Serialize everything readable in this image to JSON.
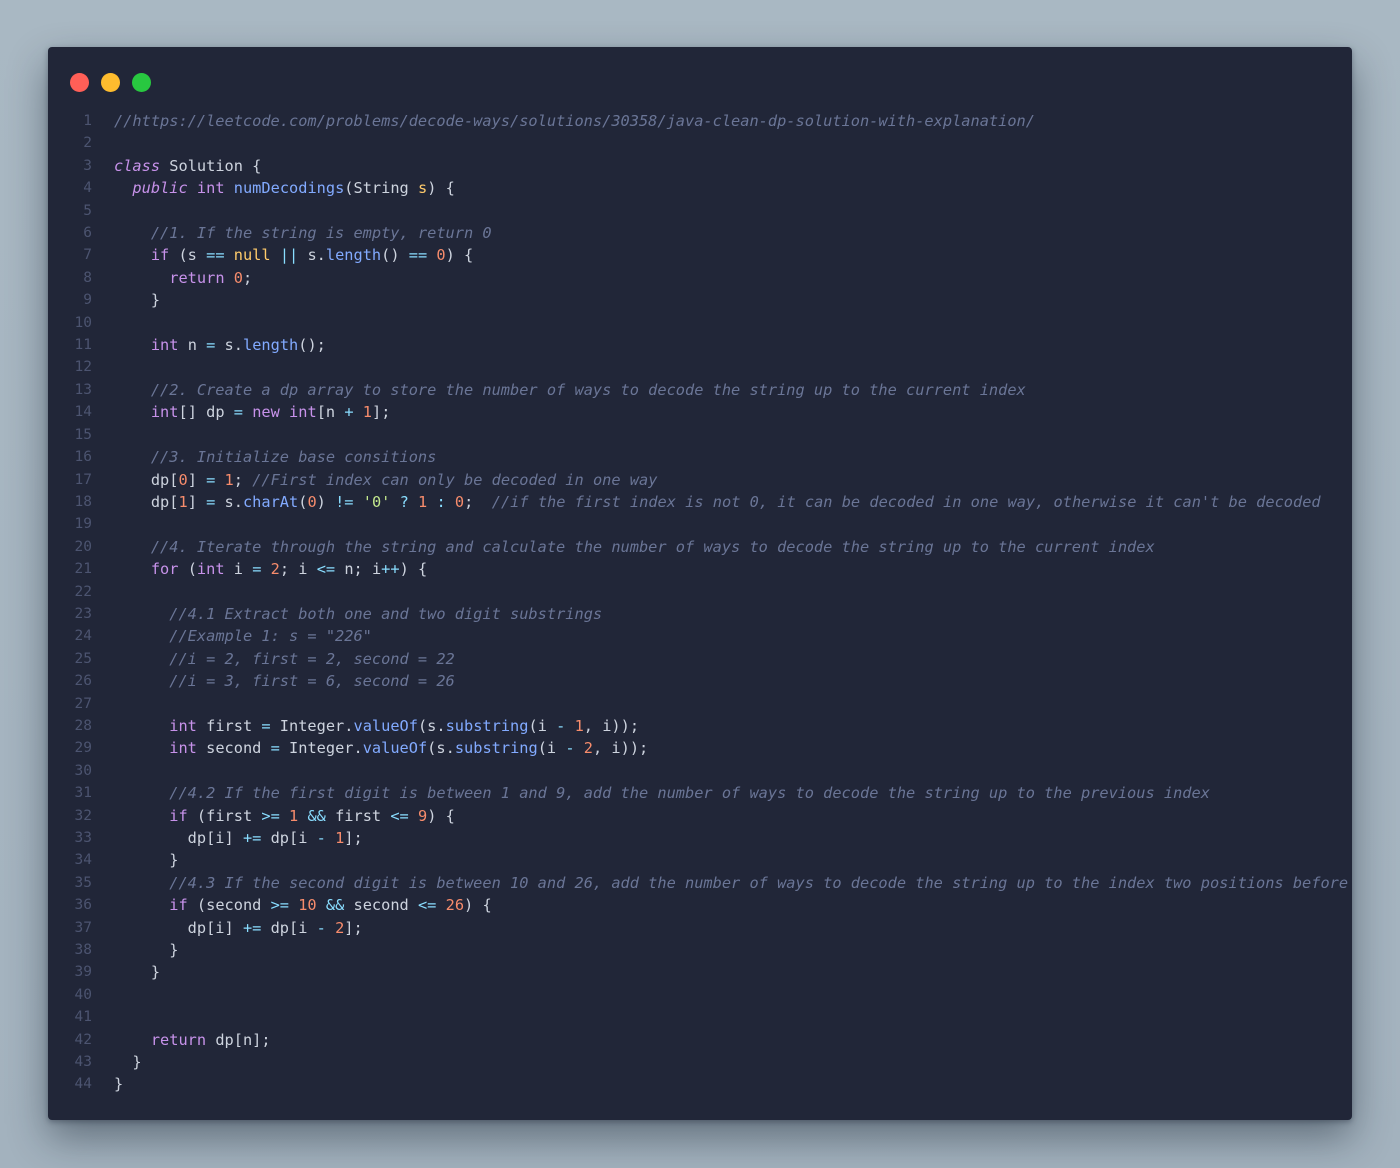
{
  "window": {
    "traffic_lights": [
      {
        "name": "close-dot",
        "color": "#ff5f57"
      },
      {
        "name": "minimize-dot",
        "color": "#febc2e"
      },
      {
        "name": "maximize-dot",
        "color": "#28c840"
      }
    ]
  },
  "syntax_colors": {
    "background": "#212638",
    "comment": "#6a7596",
    "keyword": "#c792ea",
    "number": "#f78c6c",
    "string": "#c3e88d",
    "function": "#82aaff",
    "operator": "#89ddff",
    "line_number": "#4c5470"
  },
  "code_lines": [
    [
      [
        "c",
        "//https://leetcode.com/problems/decode-ways/solutions/30358/java-clean-dp-solution-with-explanation/"
      ]
    ],
    [],
    [
      [
        "ki",
        "class"
      ],
      [
        "",
        " Solution {"
      ]
    ],
    [
      [
        "",
        "  "
      ],
      [
        "ki",
        "public"
      ],
      [
        "",
        " "
      ],
      [
        "k",
        "int"
      ],
      [
        "",
        " "
      ],
      [
        "f",
        "numDecodings"
      ],
      [
        "",
        "(String "
      ],
      [
        "t",
        "s"
      ],
      [
        "",
        ") {"
      ]
    ],
    [],
    [
      [
        "",
        "    "
      ],
      [
        "c",
        "//1. If the string is empty, return 0"
      ]
    ],
    [
      [
        "",
        "    "
      ],
      [
        "k",
        "if"
      ],
      [
        "",
        " (s "
      ],
      [
        "o",
        "=="
      ],
      [
        "",
        " "
      ],
      [
        "t",
        "null"
      ],
      [
        "",
        " "
      ],
      [
        "o",
        "||"
      ],
      [
        "",
        " s."
      ],
      [
        "f",
        "length"
      ],
      [
        "",
        "() "
      ],
      [
        "o",
        "=="
      ],
      [
        "",
        " "
      ],
      [
        "n",
        "0"
      ],
      [
        "",
        ") {"
      ]
    ],
    [
      [
        "",
        "      "
      ],
      [
        "k",
        "return"
      ],
      [
        "",
        " "
      ],
      [
        "n",
        "0"
      ],
      [
        "",
        ";"
      ]
    ],
    [
      [
        "",
        "    }"
      ]
    ],
    [],
    [
      [
        "",
        "    "
      ],
      [
        "k",
        "int"
      ],
      [
        "",
        " n "
      ],
      [
        "o",
        "="
      ],
      [
        "",
        " s."
      ],
      [
        "f",
        "length"
      ],
      [
        "",
        "();"
      ]
    ],
    [],
    [
      [
        "",
        "    "
      ],
      [
        "c",
        "//2. Create a dp array to store the number of ways to decode the string up to the current index"
      ]
    ],
    [
      [
        "",
        "    "
      ],
      [
        "k",
        "int"
      ],
      [
        "",
        "[] dp "
      ],
      [
        "o",
        "="
      ],
      [
        "",
        " "
      ],
      [
        "k",
        "new"
      ],
      [
        "",
        " "
      ],
      [
        "k",
        "int"
      ],
      [
        "",
        "[n "
      ],
      [
        "o",
        "+"
      ],
      [
        "",
        " "
      ],
      [
        "n",
        "1"
      ],
      [
        "",
        "];"
      ]
    ],
    [],
    [
      [
        "",
        "    "
      ],
      [
        "c",
        "//3. Initialize base consitions"
      ]
    ],
    [
      [
        "",
        "    dp["
      ],
      [
        "n",
        "0"
      ],
      [
        "",
        "] "
      ],
      [
        "o",
        "="
      ],
      [
        "",
        " "
      ],
      [
        "n",
        "1"
      ],
      [
        "",
        "; "
      ],
      [
        "c",
        "//First index can only be decoded in one way"
      ]
    ],
    [
      [
        "",
        "    dp["
      ],
      [
        "n",
        "1"
      ],
      [
        "",
        "] "
      ],
      [
        "o",
        "="
      ],
      [
        "",
        " s."
      ],
      [
        "f",
        "charAt"
      ],
      [
        "",
        "("
      ],
      [
        "n",
        "0"
      ],
      [
        "",
        ") "
      ],
      [
        "o",
        "!="
      ],
      [
        "",
        " "
      ],
      [
        "s",
        "'0'"
      ],
      [
        "",
        " "
      ],
      [
        "o",
        "?"
      ],
      [
        "",
        " "
      ],
      [
        "n",
        "1"
      ],
      [
        "",
        " "
      ],
      [
        "o",
        ":"
      ],
      [
        "",
        " "
      ],
      [
        "n",
        "0"
      ],
      [
        "",
        ";  "
      ],
      [
        "c",
        "//if the first index is not 0, it can be decoded in one way, otherwise it can't be decoded"
      ]
    ],
    [],
    [
      [
        "",
        "    "
      ],
      [
        "c",
        "//4. Iterate through the string and calculate the number of ways to decode the string up to the current index"
      ]
    ],
    [
      [
        "",
        "    "
      ],
      [
        "k",
        "for"
      ],
      [
        "",
        " ("
      ],
      [
        "k",
        "int"
      ],
      [
        "",
        " i "
      ],
      [
        "o",
        "="
      ],
      [
        "",
        " "
      ],
      [
        "n",
        "2"
      ],
      [
        "",
        "; i "
      ],
      [
        "o",
        "<="
      ],
      [
        "",
        " n; i"
      ],
      [
        "o",
        "++"
      ],
      [
        "",
        ") {"
      ]
    ],
    [],
    [
      [
        "",
        "      "
      ],
      [
        "c",
        "//4.1 Extract both one and two digit substrings"
      ]
    ],
    [
      [
        "",
        "      "
      ],
      [
        "c",
        "//Example 1: s = \"226\""
      ]
    ],
    [
      [
        "",
        "      "
      ],
      [
        "c",
        "//i = 2, first = 2, second = 22"
      ]
    ],
    [
      [
        "",
        "      "
      ],
      [
        "c",
        "//i = 3, first = 6, second = 26"
      ]
    ],
    [],
    [
      [
        "",
        "      "
      ],
      [
        "k",
        "int"
      ],
      [
        "",
        " first "
      ],
      [
        "o",
        "="
      ],
      [
        "",
        " Integer."
      ],
      [
        "f",
        "valueOf"
      ],
      [
        "",
        "(s."
      ],
      [
        "f",
        "substring"
      ],
      [
        "",
        "(i "
      ],
      [
        "o",
        "-"
      ],
      [
        "",
        " "
      ],
      [
        "n",
        "1"
      ],
      [
        "",
        ", i));"
      ]
    ],
    [
      [
        "",
        "      "
      ],
      [
        "k",
        "int"
      ],
      [
        "",
        " second "
      ],
      [
        "o",
        "="
      ],
      [
        "",
        " Integer."
      ],
      [
        "f",
        "valueOf"
      ],
      [
        "",
        "(s."
      ],
      [
        "f",
        "substring"
      ],
      [
        "",
        "(i "
      ],
      [
        "o",
        "-"
      ],
      [
        "",
        " "
      ],
      [
        "n",
        "2"
      ],
      [
        "",
        ", i));"
      ]
    ],
    [],
    [
      [
        "",
        "      "
      ],
      [
        "c",
        "//4.2 If the first digit is between 1 and 9, add the number of ways to decode the string up to the previous index"
      ]
    ],
    [
      [
        "",
        "      "
      ],
      [
        "k",
        "if"
      ],
      [
        "",
        " (first "
      ],
      [
        "o",
        ">="
      ],
      [
        "",
        " "
      ],
      [
        "n",
        "1"
      ],
      [
        "",
        " "
      ],
      [
        "o",
        "&&"
      ],
      [
        "",
        " first "
      ],
      [
        "o",
        "<="
      ],
      [
        "",
        " "
      ],
      [
        "n",
        "9"
      ],
      [
        "",
        ") {"
      ]
    ],
    [
      [
        "",
        "        dp[i] "
      ],
      [
        "o",
        "+="
      ],
      [
        "",
        " dp[i "
      ],
      [
        "o",
        "-"
      ],
      [
        "",
        " "
      ],
      [
        "n",
        "1"
      ],
      [
        "",
        "];"
      ]
    ],
    [
      [
        "",
        "      }"
      ]
    ],
    [
      [
        "",
        "      "
      ],
      [
        "c",
        "//4.3 If the second digit is between 10 and 26, add the number of ways to decode the string up to the index two positions before"
      ]
    ],
    [
      [
        "",
        "      "
      ],
      [
        "k",
        "if"
      ],
      [
        "",
        " (second "
      ],
      [
        "o",
        ">="
      ],
      [
        "",
        " "
      ],
      [
        "n",
        "10"
      ],
      [
        "",
        " "
      ],
      [
        "o",
        "&&"
      ],
      [
        "",
        " second "
      ],
      [
        "o",
        "<="
      ],
      [
        "",
        " "
      ],
      [
        "n",
        "26"
      ],
      [
        "",
        ") {"
      ]
    ],
    [
      [
        "",
        "        dp[i] "
      ],
      [
        "o",
        "+="
      ],
      [
        "",
        " dp[i "
      ],
      [
        "o",
        "-"
      ],
      [
        "",
        " "
      ],
      [
        "n",
        "2"
      ],
      [
        "",
        "];"
      ]
    ],
    [
      [
        "",
        "      }"
      ]
    ],
    [
      [
        "",
        "    }"
      ]
    ],
    [],
    [],
    [
      [
        "",
        "    "
      ],
      [
        "k",
        "return"
      ],
      [
        "",
        " dp[n];"
      ]
    ],
    [
      [
        "",
        "  }"
      ]
    ],
    [
      [
        "",
        "}"
      ]
    ]
  ]
}
